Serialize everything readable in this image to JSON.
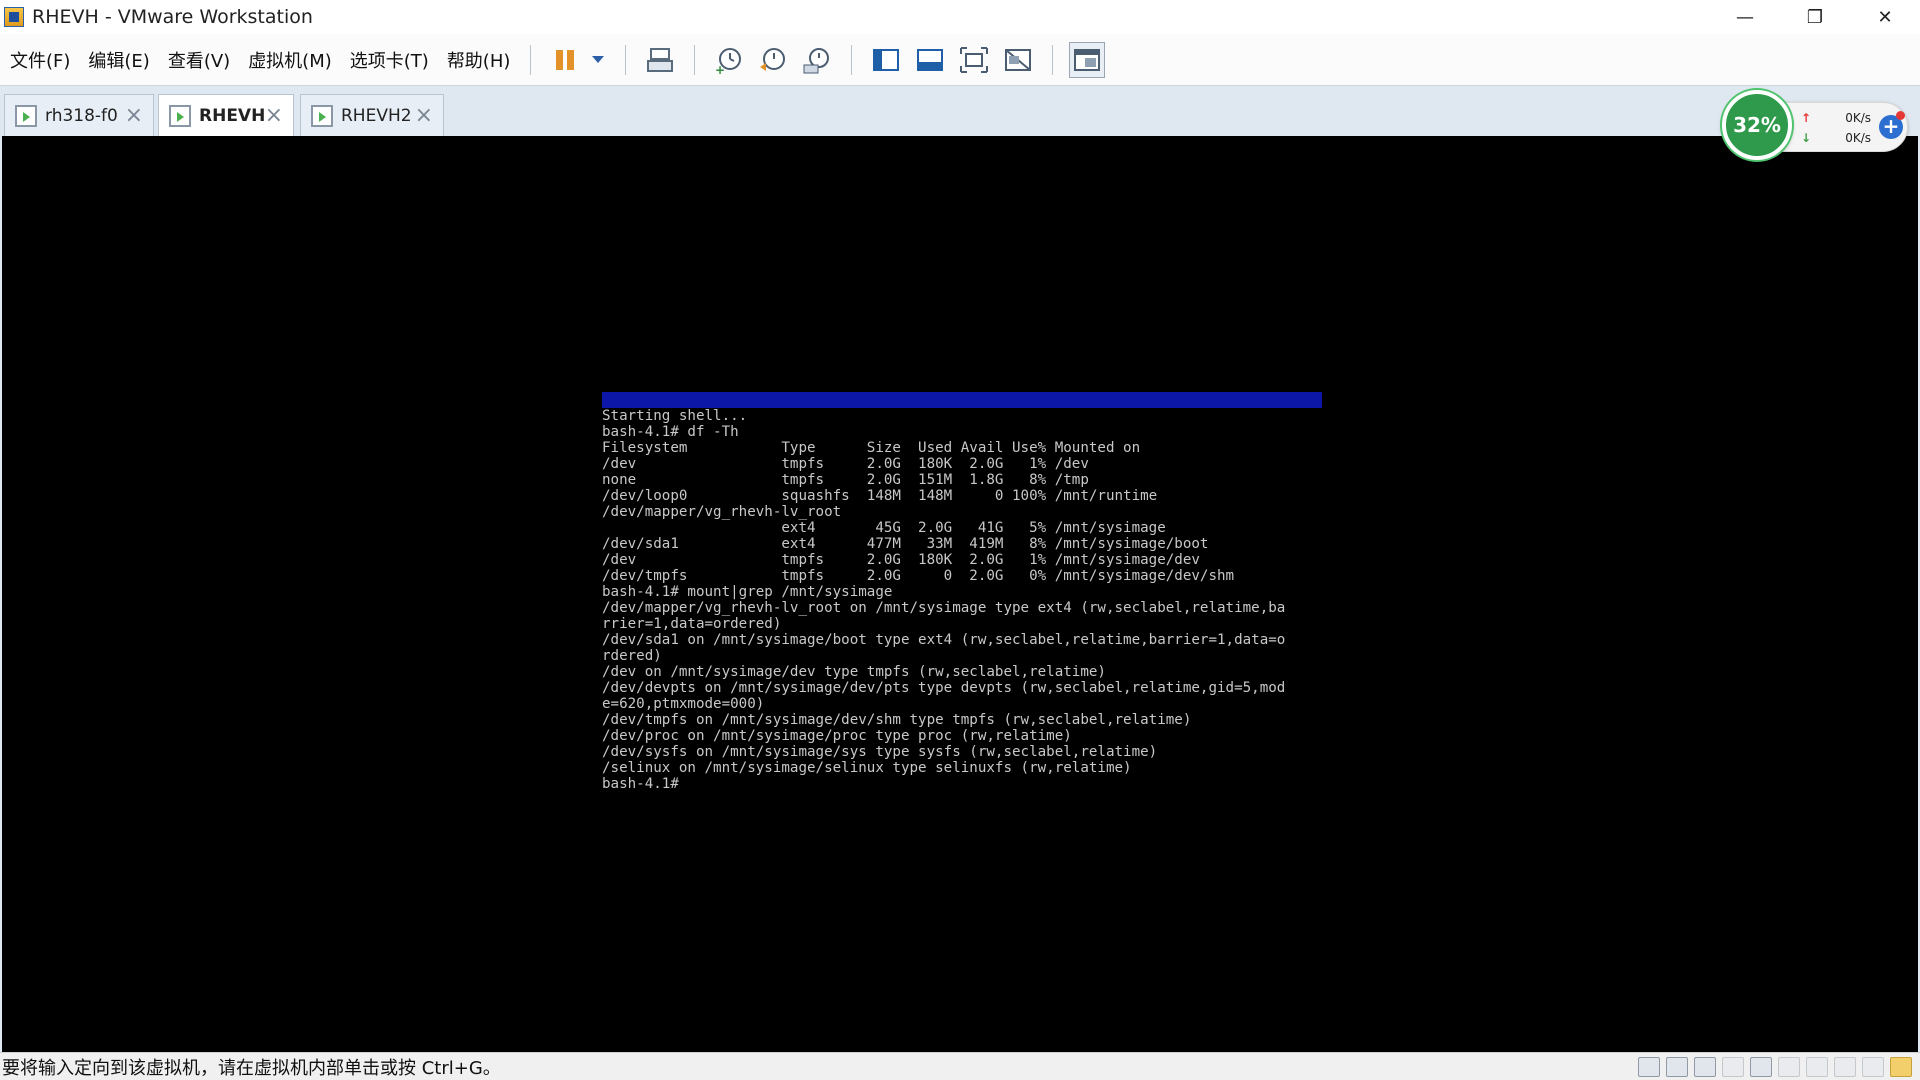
{
  "window": {
    "title": "RHEVH - VMware Workstation",
    "controls": {
      "minimize": "—",
      "restore": "❐",
      "close": "✕"
    }
  },
  "menu": [
    "文件(F)",
    "编辑(E)",
    "查看(V)",
    "虚拟机(M)",
    "选项卡(T)",
    "帮助(H)"
  ],
  "toolbar": {
    "buttons": [
      "pause-icon",
      "dropdown-arrow-icon",
      "send-ctrl-alt-del-icon",
      "snapshot-take-icon",
      "snapshot-revert-icon",
      "snapshot-manager-icon",
      "library-view-icon",
      "thumbnail-bar-icon",
      "full-screen-icon",
      "unity-icon",
      "console-view-icon"
    ]
  },
  "tabs": [
    {
      "label": "rh318-f0",
      "active": false
    },
    {
      "label": "RHEVH",
      "active": true
    },
    {
      "label": "RHEVH2",
      "active": false
    }
  ],
  "net_widget": {
    "cpu_percent": "32%",
    "upload": "0K/s",
    "download": "0K/s",
    "plus": "+"
  },
  "terminal": {
    "lines": [
      "Starting shell...",
      "bash-4.1# df -Th",
      "Filesystem           Type      Size  Used Avail Use% Mounted on",
      "/dev                 tmpfs     2.0G  180K  2.0G   1% /dev",
      "none                 tmpfs     2.0G  151M  1.8G   8% /tmp",
      "/dev/loop0           squashfs  148M  148M     0 100% /mnt/runtime",
      "/dev/mapper/vg_rhevh-lv_root",
      "                     ext4       45G  2.0G   41G   5% /mnt/sysimage",
      "/dev/sda1            ext4      477M   33M  419M   8% /mnt/sysimage/boot",
      "/dev                 tmpfs     2.0G  180K  2.0G   1% /mnt/sysimage/dev",
      "/dev/tmpfs           tmpfs     2.0G     0  2.0G   0% /mnt/sysimage/dev/shm",
      "bash-4.1# mount|grep /mnt/sysimage",
      "/dev/mapper/vg_rhevh-lv_root on /mnt/sysimage type ext4 (rw,seclabel,relatime,ba",
      "rrier=1,data=ordered)",
      "/dev/sda1 on /mnt/sysimage/boot type ext4 (rw,seclabel,relatime,barrier=1,data=o",
      "rdered)",
      "/dev on /mnt/sysimage/dev type tmpfs (rw,seclabel,relatime)",
      "/dev/devpts on /mnt/sysimage/dev/pts type devpts (rw,seclabel,relatime,gid=5,mod",
      "e=620,ptmxmode=000)",
      "/dev/tmpfs on /mnt/sysimage/dev/shm type tmpfs (rw,seclabel,relatime)",
      "/dev/proc on /mnt/sysimage/proc type proc (rw,relatime)",
      "/dev/sysfs on /mnt/sysimage/sys type sysfs (rw,seclabel,relatime)",
      "/selinux on /mnt/sysimage/selinux type selinuxfs (rw,relatime)",
      "bash-4.1#"
    ]
  },
  "status_bar": {
    "message": "要将输入定向到该虚拟机，请在虚拟机内部单击或按 Ctrl+G。"
  },
  "colors": {
    "console_bg": "#000000",
    "console_banner": "#0c17a8",
    "terminal_text": "#c8c8c8",
    "pause_orange": "#e3922a",
    "cpu_green": "#2f9a4c"
  }
}
